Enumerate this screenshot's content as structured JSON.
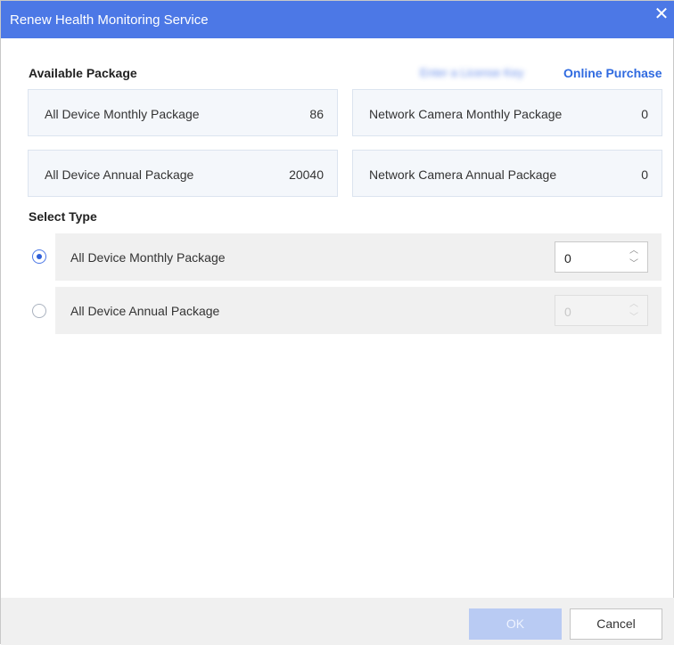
{
  "dialog": {
    "title": "Renew Health Monitoring Service",
    "close_glyph": "✕"
  },
  "available": {
    "title": "Available Package",
    "blurred_link": "Enter a License Key",
    "online_purchase": "Online Purchase",
    "packages": [
      {
        "label": "All Device Monthly Package",
        "value": "86"
      },
      {
        "label": "Network Camera Monthly Package",
        "value": "0"
      },
      {
        "label": "All Device Annual Package",
        "value": "20040"
      },
      {
        "label": "Network Camera Annual Package",
        "value": "0"
      }
    ]
  },
  "select_type": {
    "title": "Select Type",
    "options": [
      {
        "label": "All Device Monthly Package",
        "quantity": "0",
        "selected": true
      },
      {
        "label": "All Device Annual Package",
        "quantity": "0",
        "selected": false
      }
    ]
  },
  "footer": {
    "ok_label": "OK",
    "cancel_label": "Cancel"
  },
  "colors": {
    "accent": "#4c78e6",
    "ok_disabled": "#b9cbf3"
  }
}
